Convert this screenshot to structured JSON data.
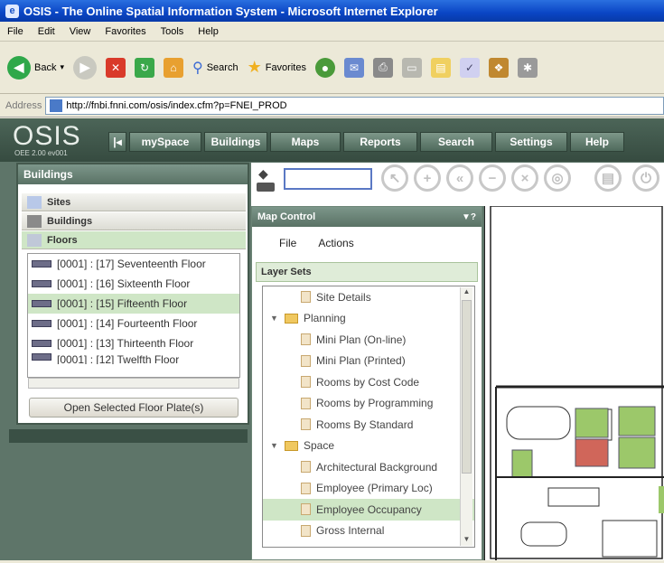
{
  "browser": {
    "title": "OSIS - The Online Spatial Information System - Microsoft Internet Explorer",
    "menu": [
      "File",
      "Edit",
      "View",
      "Favorites",
      "Tools",
      "Help"
    ],
    "toolbar": {
      "back": "Back",
      "search": "Search",
      "favorites": "Favorites"
    },
    "address": {
      "label": "Address",
      "url": "http://fnbi.fnni.com/osis/index.cfm?p=FNEI_PROD"
    }
  },
  "app": {
    "logo": "OSIS",
    "logo_sub": "OEE 2.00 ev001",
    "nav": [
      "mySpace",
      "Buildings",
      "Maps",
      "Reports",
      "Search",
      "Settings",
      "Help"
    ]
  },
  "buildings_panel": {
    "title": "Buildings",
    "sections": [
      "Sites",
      "Buildings",
      "Floors"
    ],
    "floors": [
      "[0001] : [17] Seventeenth Floor",
      "[0001] : [16] Sixteenth Floor",
      "[0001] : [15] Fifteenth Floor",
      "[0001] : [14] Fourteenth Floor",
      "[0001] : [13] Thirteenth Floor",
      "[0001] : [12] Twelfth Floor"
    ],
    "open_button": "Open Selected Floor Plate(s)"
  },
  "map_control": {
    "title": "Map Control",
    "menu": [
      "File",
      "Actions"
    ],
    "layer_sets": "Layer Sets",
    "tree": [
      {
        "label": "Site Details",
        "type": "doc",
        "indent": 1
      },
      {
        "label": "Planning",
        "type": "folder",
        "indent": 0
      },
      {
        "label": "Mini Plan (On-line)",
        "type": "doc",
        "indent": 1
      },
      {
        "label": "Mini Plan (Printed)",
        "type": "doc",
        "indent": 1
      },
      {
        "label": "Rooms by Cost Code",
        "type": "doc",
        "indent": 1
      },
      {
        "label": "Rooms by Programming",
        "type": "doc",
        "indent": 1
      },
      {
        "label": "Rooms By Standard",
        "type": "doc",
        "indent": 1
      },
      {
        "label": "Space",
        "type": "folder",
        "indent": 0
      },
      {
        "label": "Architectural Background",
        "type": "doc",
        "indent": 1
      },
      {
        "label": "Employee (Primary Loc)",
        "type": "doc",
        "indent": 1
      },
      {
        "label": "Employee Occupancy",
        "type": "doc",
        "indent": 1,
        "selected": true
      },
      {
        "label": "Gross Internal",
        "type": "doc",
        "indent": 1
      }
    ]
  },
  "colors": {
    "accent": "#5a7265",
    "selected": "#cfe6c6",
    "title": "#0a45c4"
  }
}
